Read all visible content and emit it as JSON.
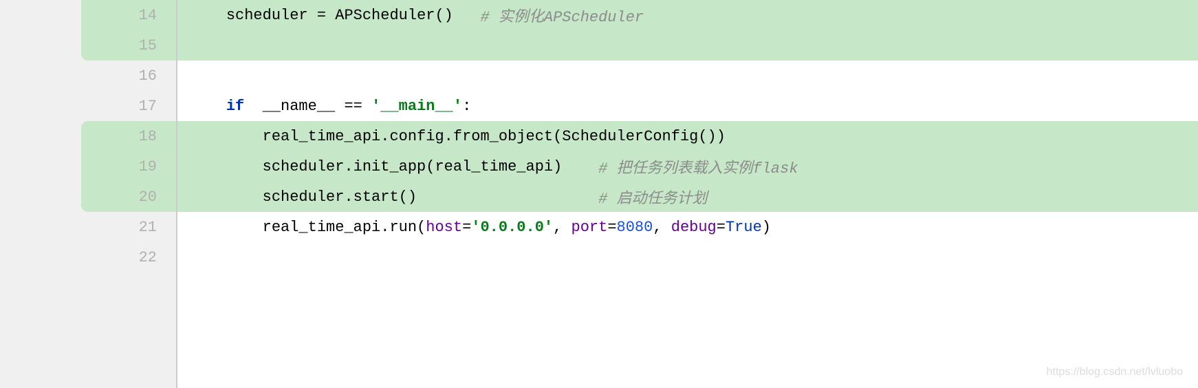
{
  "lines": [
    {
      "num": "14",
      "hl": true
    },
    {
      "num": "15",
      "hl": true
    },
    {
      "num": "16",
      "hl": false
    },
    {
      "num": "17",
      "hl": false
    },
    {
      "num": "18",
      "hl": true
    },
    {
      "num": "19",
      "hl": true
    },
    {
      "num": "20",
      "hl": true
    },
    {
      "num": "21",
      "hl": false
    },
    {
      "num": "22",
      "hl": false
    }
  ],
  "code": {
    "l14": {
      "indent": "    ",
      "var": "scheduler ",
      "eq": "= ",
      "call": "APScheduler()   ",
      "comment": "# 实例化APScheduler"
    },
    "l15": {
      "blank": ""
    },
    "l16": {
      "blank": ""
    },
    "l17": {
      "indent": "    ",
      "kw": "if ",
      "name1": " __name__ ",
      "eq": "== ",
      "str": "'__main__'",
      "colon": ":"
    },
    "l18": {
      "indent": "        ",
      "txt": "real_time_api.config.from_object(SchedulerConfig())"
    },
    "l19": {
      "indent": "        ",
      "txt": "scheduler.init_app(real_time_api)    ",
      "comment": "# 把任务列表载入实例flask"
    },
    "l20": {
      "indent": "        ",
      "txt": "scheduler.start()                    ",
      "comment": "# 启动任务计划"
    },
    "l21": {
      "indent": "        ",
      "txt1": "real_time_api.run(",
      "p1": "host",
      "eq1": "=",
      "s1": "'0.0.0.0'",
      "c1": ", ",
      "p2": "port",
      "eq2": "=",
      "n2": "8080",
      "c2": ", ",
      "p3": "debug",
      "eq3": "=",
      "v3": "True",
      "close": ")"
    },
    "l22": {
      "blank": ""
    }
  },
  "watermark": "https://blog.csdn.net/lvluobo"
}
